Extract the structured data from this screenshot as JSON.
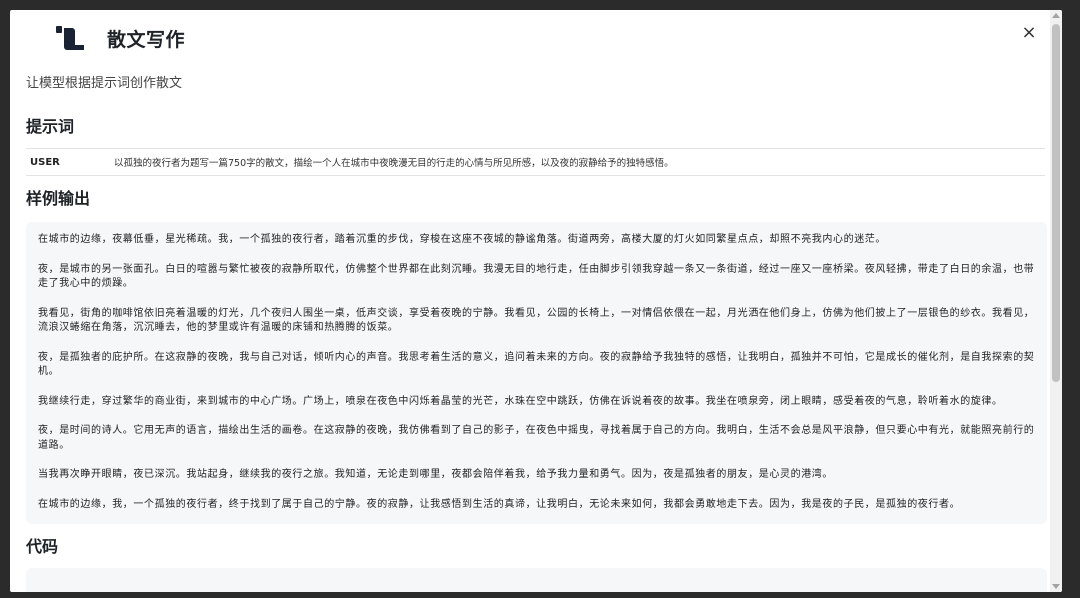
{
  "header": {
    "title": "散文写作",
    "logo_icon": "brand-logo-icon",
    "close_label": "×"
  },
  "subtitle": "让模型根据提示词创作散文",
  "prompt_section": {
    "heading": "提示词",
    "rows": [
      {
        "role": "USER",
        "content": "以孤独的夜行者为题写一篇750字的散文，描绘一个人在城市中夜晚漫无目的行走的心情与所见所感，以及夜的寂静给予的独特感悟。"
      }
    ]
  },
  "sample_section": {
    "heading": "样例输出",
    "paragraphs": [
      "在城市的边缘，夜幕低垂，星光稀疏。我，一个孤独的夜行者，踏着沉重的步伐，穿梭在这座不夜城的静谧角落。街道两旁，高楼大厦的灯火如同繁星点点，却照不亮我内心的迷茫。",
      "夜，是城市的另一张面孔。白日的喧嚣与繁忙被夜的寂静所取代，仿佛整个世界都在此刻沉睡。我漫无目的地行走，任由脚步引领我穿越一条又一条街道，经过一座又一座桥梁。夜风轻拂，带走了白日的余温，也带走了我心中的烦躁。",
      "我看见，街角的咖啡馆依旧亮着温暖的灯光，几个夜归人围坐一桌，低声交谈，享受着夜晚的宁静。我看见，公园的长椅上，一对情侣依偎在一起，月光洒在他们身上，仿佛为他们披上了一层银色的纱衣。我看见，流浪汉蜷缩在角落，沉沉睡去，他的梦里或许有温暖的床铺和热腾腾的饭菜。",
      "夜，是孤独者的庇护所。在这寂静的夜晚，我与自己对话，倾听内心的声音。我思考着生活的意义，追问着未来的方向。夜的寂静给予我独特的感悟，让我明白，孤独并不可怕，它是成长的催化剂，是自我探索的契机。",
      "我继续行走，穿过繁华的商业街，来到城市的中心广场。广场上，喷泉在夜色中闪烁着晶莹的光芒，水珠在空中跳跃，仿佛在诉说着夜的故事。我坐在喷泉旁，闭上眼睛，感受着夜的气息，聆听着水的旋律。",
      "夜，是时间的诗人。它用无声的语言，描绘出生活的画卷。在这寂静的夜晚，我仿佛看到了自己的影子，在夜色中摇曳，寻找着属于自己的方向。我明白，生活不会总是风平浪静，但只要心中有光，就能照亮前行的道路。",
      "当我再次睁开眼睛，夜已深沉。我站起身，继续我的夜行之旅。我知道，无论走到哪里，夜都会陪伴着我，给予我力量和勇气。因为，夜是孤独者的朋友，是心灵的港湾。",
      "在城市的边缘，我，一个孤独的夜行者，终于找到了属于自己的宁静。夜的寂静，让我感悟到生活的真谛，让我明白，无论未来如何，我都会勇敢地走下去。因为，我是夜的子民，是孤独的夜行者。"
    ]
  },
  "code_section": {
    "heading": "代码"
  },
  "colors": {
    "backdrop": "#2b2b2b",
    "panel": "#ffffff",
    "sample_bg": "#f6f7f9",
    "text_primary": "#1f2328"
  }
}
